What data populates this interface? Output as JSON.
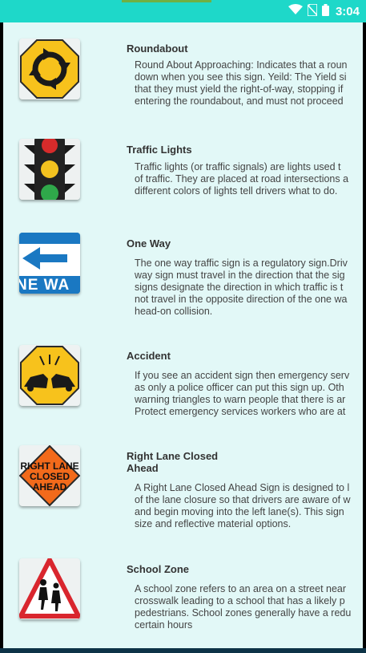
{
  "status": {
    "time": "3:04"
  },
  "signs": [
    {
      "title": "Roundabout",
      "lines": [
        "Round About Approaching: Indicates that a roun",
        "down when you see this sign. Yeild: The Yield si",
        "that they must yield the right-of-way, stopping if",
        "entering the roundabout, and must not proceed"
      ],
      "icon": "roundabout-sign-icon"
    },
    {
      "title": "Traffic Lights",
      "lines": [
        "Traffic lights (or traffic signals) are lights used t",
        "of traffic. They are placed at road intersections a",
        "different colors of lights tell drivers what to do."
      ],
      "icon": "traffic-light-icon"
    },
    {
      "title": "One Way",
      "lines": [
        "The one way traffic sign is a regulatory sign.Driv",
        "way sign must travel in the direction that the sig",
        "signs designate the direction in which traffic is t",
        "not travel in the opposite direction of the one wa",
        "head-on collision."
      ],
      "sign_text": "NE WA",
      "icon": "one-way-sign-icon"
    },
    {
      "title": "Accident",
      "lines": [
        "If you see an accident sign then emergency serv",
        "as only a police officer can put this sign up. Oth",
        "warning triangles to warn people that there is ar",
        "Protect emergency services workers who are at"
      ],
      "icon": "accident-sign-icon"
    },
    {
      "title": "Right Lane Closed Ahead",
      "title_lines": [
        "Right Lane Closed",
        "Ahead"
      ],
      "lines": [
        "A Right Lane Closed Ahead Sign is designed to l",
        "of the lane closure so that drivers are aware of w",
        "and begin moving into the left lane(s). This sign",
        "size and reflective material options."
      ],
      "sign_lines": [
        "RIGHT LANE",
        "CLOSED",
        "AHEAD"
      ],
      "icon": "right-lane-closed-sign-icon"
    },
    {
      "title": "School Zone",
      "lines": [
        "A school zone refers to an area on a street near",
        "crosswalk leading to a school that has a likely p",
        "pedestrians. School zones generally have a redu",
        "certain hours"
      ],
      "icon": "school-zone-sign-icon"
    }
  ],
  "colors": {
    "status_bar": "#1ed8c9",
    "list_background": "#e2f8f7",
    "sign_yellow": "#f7c21c",
    "sign_orange": "#f26a1b",
    "sign_blue": "#1a78c2",
    "sign_red": "#d9262e"
  }
}
